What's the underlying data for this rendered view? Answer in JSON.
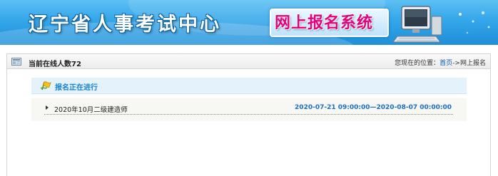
{
  "header": {
    "title": "辽宁省人事考试中心",
    "system_name": "网上报名系统"
  },
  "status_bar": {
    "online_label": "当前在线人数",
    "online_count": "72",
    "location_prefix": "您现在的位置：",
    "home_link": "首页",
    "location_separator": "->",
    "current_page": "网上报名"
  },
  "section": {
    "title": "报名正在进行"
  },
  "exams": [
    {
      "name": "2020年10月二级建造师",
      "period": "2020-07-21 09:00:00—2020-08-07 00:00:00"
    }
  ],
  "colors": {
    "banner_blue": "#34a6ea",
    "section_title": "#1581d6",
    "date_text": "#1a6fc4",
    "system_name": "#e6007e"
  },
  "icons": {
    "status": "home-icon",
    "section": "flag-icon",
    "banner": "computer-icon"
  }
}
